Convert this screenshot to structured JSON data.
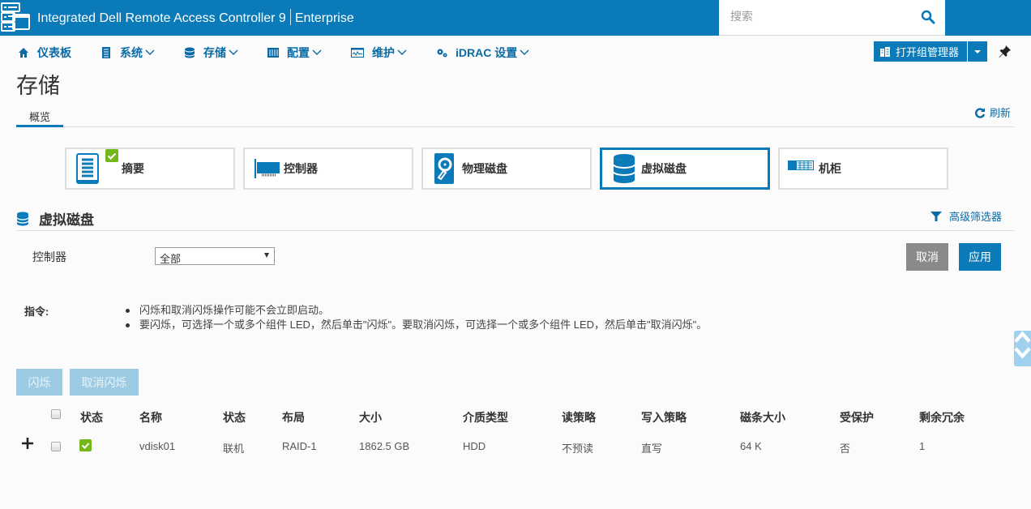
{
  "header": {
    "title": "Integrated Dell Remote Access Controller 9",
    "edition": "Enterprise",
    "search_placeholder": "搜索",
    "icons": [
      "server-logo-icon",
      "search-icon",
      "unlock-icon",
      "user-icon",
      "help-icon"
    ]
  },
  "nav": {
    "items": [
      {
        "label": "仪表板",
        "icon": "home-icon",
        "has_dropdown": false
      },
      {
        "label": "系统",
        "icon": "system-icon",
        "has_dropdown": true
      },
      {
        "label": "存储",
        "icon": "storage-icon",
        "has_dropdown": true
      },
      {
        "label": "配置",
        "icon": "configuration-icon",
        "has_dropdown": true
      },
      {
        "label": "维护",
        "icon": "maintenance-icon",
        "has_dropdown": true
      },
      {
        "label": "iDRAC 设置",
        "icon": "gears-icon",
        "has_dropdown": true
      }
    ],
    "group_manager_label": "打开组管理器"
  },
  "page": {
    "title": "存储",
    "tabs": [
      {
        "label": "概览",
        "active": true
      }
    ],
    "refresh_label": "刷新"
  },
  "cards": [
    {
      "label": "摘要",
      "icon": "summary-icon",
      "status": "ok",
      "active": false
    },
    {
      "label": "控制器",
      "icon": "controller-icon",
      "active": false
    },
    {
      "label": "物理磁盘",
      "icon": "physical-disk-icon",
      "active": false
    },
    {
      "label": "虚拟磁盘",
      "icon": "virtual-disk-icon",
      "active": true
    },
    {
      "label": "机柜",
      "icon": "enclosure-icon",
      "active": false
    }
  ],
  "section": {
    "title": "虚拟磁盘",
    "advanced_filter_label": "高级筛选器",
    "controller_label": "控制器",
    "controller_value": "全部",
    "cancel_label": "取消",
    "apply_label": "应用"
  },
  "instructions": {
    "label": "指令:",
    "items": [
      "闪烁和取消闪烁操作可能不会立即启动。",
      "要闪烁，可选择一个或多个组件 LED，然后单击\"闪烁\"。要取消闪烁，可选择一个或多个组件 LED，然后单击\"取消闪烁\"。"
    ]
  },
  "actions": {
    "blink_label": "闪烁",
    "unblink_label": "取消闪烁"
  },
  "table": {
    "columns": [
      "状态",
      "名称",
      "状态",
      "布局",
      "大小",
      "介质类型",
      "读策略",
      "写入策略",
      "磁条大小",
      "受保护",
      "剩余冗余"
    ],
    "rows": [
      {
        "status": "ok",
        "name": "vdisk01",
        "state": "联机",
        "layout": "RAID-1",
        "size": "1862.5 GB",
        "media_type": "HDD",
        "read_policy": "不预读",
        "write_policy": "直写",
        "stripe_size": "64 K",
        "secured": "否",
        "remaining_redundancy": "1"
      }
    ]
  },
  "colors": {
    "brand": "#0a7ab8",
    "ok": "#74b71b",
    "disabled_button": "#9ccbe3",
    "cancel_button": "#8a8a8a"
  }
}
